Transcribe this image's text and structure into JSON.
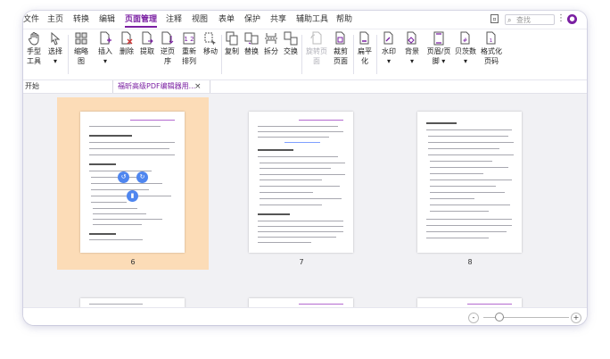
{
  "menu": {
    "items": [
      "文件",
      "主页",
      "转换",
      "编辑",
      "页面管理",
      "注释",
      "视图",
      "表单",
      "保护",
      "共享",
      "辅助工具",
      "帮助"
    ],
    "active_index": 4,
    "search_placeholder": "查找"
  },
  "ribbon": {
    "tools": [
      {
        "l1": "手型",
        "l2": "工具",
        "icon": "hand-icon"
      },
      {
        "l1": "选择",
        "l2": "▾",
        "icon": "cursor-icon"
      },
      {
        "l1": "缩略",
        "l2": "图",
        "icon": "thumbnail-icon"
      },
      {
        "l1": "插入",
        "l2": "▾",
        "icon": "insert-page-icon"
      },
      {
        "l1": "删除",
        "l2": "",
        "icon": "delete-page-icon"
      },
      {
        "l1": "提取",
        "l2": "",
        "icon": "extract-page-icon"
      },
      {
        "l1": "逆页",
        "l2": "序",
        "icon": "reverse-pages-icon"
      },
      {
        "l1": "重新",
        "l2": "排列",
        "icon": "rearrange-icon"
      },
      {
        "l1": "移动",
        "l2": "",
        "icon": "move-page-icon"
      },
      {
        "l1": "复制",
        "l2": "",
        "icon": "copy-page-icon"
      },
      {
        "l1": "替换",
        "l2": "",
        "icon": "replace-page-icon"
      },
      {
        "l1": "拆分",
        "l2": "",
        "icon": "split-icon"
      },
      {
        "l1": "交换",
        "l2": "",
        "icon": "swap-icon"
      },
      {
        "l1": "旋转页",
        "l2": "面",
        "icon": "rotate-page-icon"
      },
      {
        "l1": "裁剪",
        "l2": "页面",
        "icon": "crop-page-icon"
      },
      {
        "l1": "扁平",
        "l2": "化",
        "icon": "flatten-icon"
      },
      {
        "l1": "水印",
        "l2": "▾",
        "icon": "watermark-icon"
      },
      {
        "l1": "背景",
        "l2": "▾",
        "icon": "background-icon"
      },
      {
        "l1": "页眉/页",
        "l2": "脚 ▾",
        "icon": "header-footer-icon"
      },
      {
        "l1": "贝茨数",
        "l2": "▾",
        "icon": "bates-number-icon"
      },
      {
        "l1": "格式化",
        "l2": "页码",
        "icon": "format-page-number-icon"
      }
    ]
  },
  "tabs": {
    "start_label": "开始",
    "doc_label": "福昕高级PDF编辑器用...",
    "close_glyph": "×"
  },
  "pages": [
    {
      "number": "6",
      "selected": true
    },
    {
      "number": "7",
      "selected": false
    },
    {
      "number": "8",
      "selected": false
    }
  ],
  "zoom": {
    "minus": "-",
    "plus": "+"
  }
}
